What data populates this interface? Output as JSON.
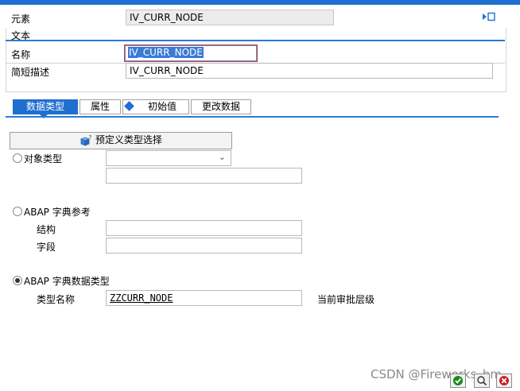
{
  "header": {
    "element_label": "元素",
    "element_value": "IV_CURR_NODE"
  },
  "text_section": {
    "title": "文本",
    "name_label": "名称",
    "name_value": "IV_CURR_NODE",
    "short_desc_label": "简短描述",
    "short_desc_value": "IV_CURR_NODE"
  },
  "tabs": [
    {
      "label": "数据类型",
      "active": true
    },
    {
      "label": "属性",
      "active": false
    },
    {
      "label": "初始值",
      "active": false
    },
    {
      "label": "更改数据",
      "active": false
    }
  ],
  "data_type": {
    "predefined_button": "预定义类型选择",
    "object_type_label": "对象类型",
    "object_type_value": "",
    "object_type_desc": "",
    "abap_dict_ref_label": "ABAP 字典参考",
    "structure_label": "结构",
    "structure_value": "",
    "field_label": "字段",
    "field_value": "",
    "abap_dict_type_label": "ABAP 字典数据类型",
    "type_name_label": "类型名称",
    "type_name_value": "ZZCURR_NODE",
    "approval_level_label": "当前审批层级",
    "selected_option": "abap_dict_type"
  },
  "watermark": "CSDN @Fireworks_hm",
  "colors": {
    "accent": "#1f6fd1",
    "section_line": "#2b7bd8",
    "ok_green": "#1a8a1a",
    "cancel_red": "#cc2222"
  }
}
